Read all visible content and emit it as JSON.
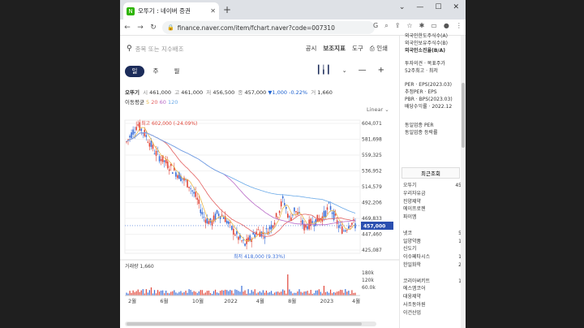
{
  "browser": {
    "tab_title": "오뚜기 : 네이버 증권",
    "tab_favicon": "N",
    "url": "finance.naver.com/item/fchart.naver?code=007310"
  },
  "toolbar": {
    "search_placeholder": "종목 또는 지수배조",
    "tools": [
      "공시",
      "보조지표",
      "도구",
      "인쇄"
    ]
  },
  "periods": [
    "일",
    "주",
    "월"
  ],
  "active_period": "일",
  "stock_info": {
    "name": "오뚜기",
    "open_label": "시",
    "open": "461,000",
    "high_label": "고",
    "high": "461,000",
    "low_label": "저",
    "low": "456,500",
    "close_label": "종",
    "close": "457,000",
    "change": "▼1,000",
    "change_pct": "-0.22%",
    "volume_label": "거",
    "volume": "1,660"
  },
  "moving_average": {
    "label": "이동평균",
    "periods": [
      "5",
      "20",
      "60",
      "120"
    ],
    "colors": [
      "#e8b84b",
      "#e36161",
      "#b86ac7",
      "#69a9e8"
    ]
  },
  "scale_mode": "Linear",
  "chart_data": {
    "type": "line",
    "price_ticks": [
      "604,071",
      "581,698",
      "559,325",
      "536,952",
      "514,579",
      "492,206",
      "469,833",
      "447,460",
      "425,087"
    ],
    "current_price_label": "457,000",
    "max_annotation": "최고 602,000 (-24.09%)",
    "min_annotation": "최저 418,000 (9.33%)",
    "volume_title": "거래량 1,660",
    "volume_ticks": [
      "180k",
      "120k",
      "60.0k"
    ],
    "x_labels": [
      "2월",
      "6월",
      "10월",
      "2022",
      "4월",
      "8월",
      "2023",
      "4월"
    ],
    "ylim": [
      418000,
      606000
    ]
  },
  "right_panel": {
    "top_items": [
      "외국인한도주식수(A)",
      "외국인보유주식수(B)",
      "외국인소진율(B/A)"
    ],
    "opinion_items": [
      "투자의견 · 목표주가",
      "52주최고 · 최저"
    ],
    "per_items": [
      "PER · EPS(2023.03)",
      "추정PER · EPS",
      "PBR · BPS(2023.03)",
      "배당수익률 · 2022.12"
    ],
    "industry_items": [
      "동일업종 PER",
      "동일업종 등락률"
    ],
    "recent_title": "최근조회",
    "recent_list": [
      {
        "name": "오뚜기",
        "value": "45"
      },
      {
        "name": "우리자유금",
        "value": ""
      },
      {
        "name": "진양제약",
        "value": ""
      },
      {
        "name": "에이프로젠",
        "value": ""
      },
      {
        "name": "파이엠",
        "value": ""
      },
      {
        "name": "",
        "value": ""
      },
      {
        "name": "넷코",
        "value": "5"
      },
      {
        "name": "일양약품",
        "value": "1"
      },
      {
        "name": "신도기",
        "value": ""
      },
      {
        "name": "이수페타시스",
        "value": "1"
      },
      {
        "name": "한일화학",
        "value": "2"
      },
      {
        "name": "",
        "value": ""
      },
      {
        "name": "코리아써키트",
        "value": "1"
      },
      {
        "name": "에스엠코어",
        "value": ""
      },
      {
        "name": "대웅제약",
        "value": ""
      },
      {
        "name": "사조동아원",
        "value": ""
      },
      {
        "name": "이건산업",
        "value": ""
      }
    ]
  }
}
